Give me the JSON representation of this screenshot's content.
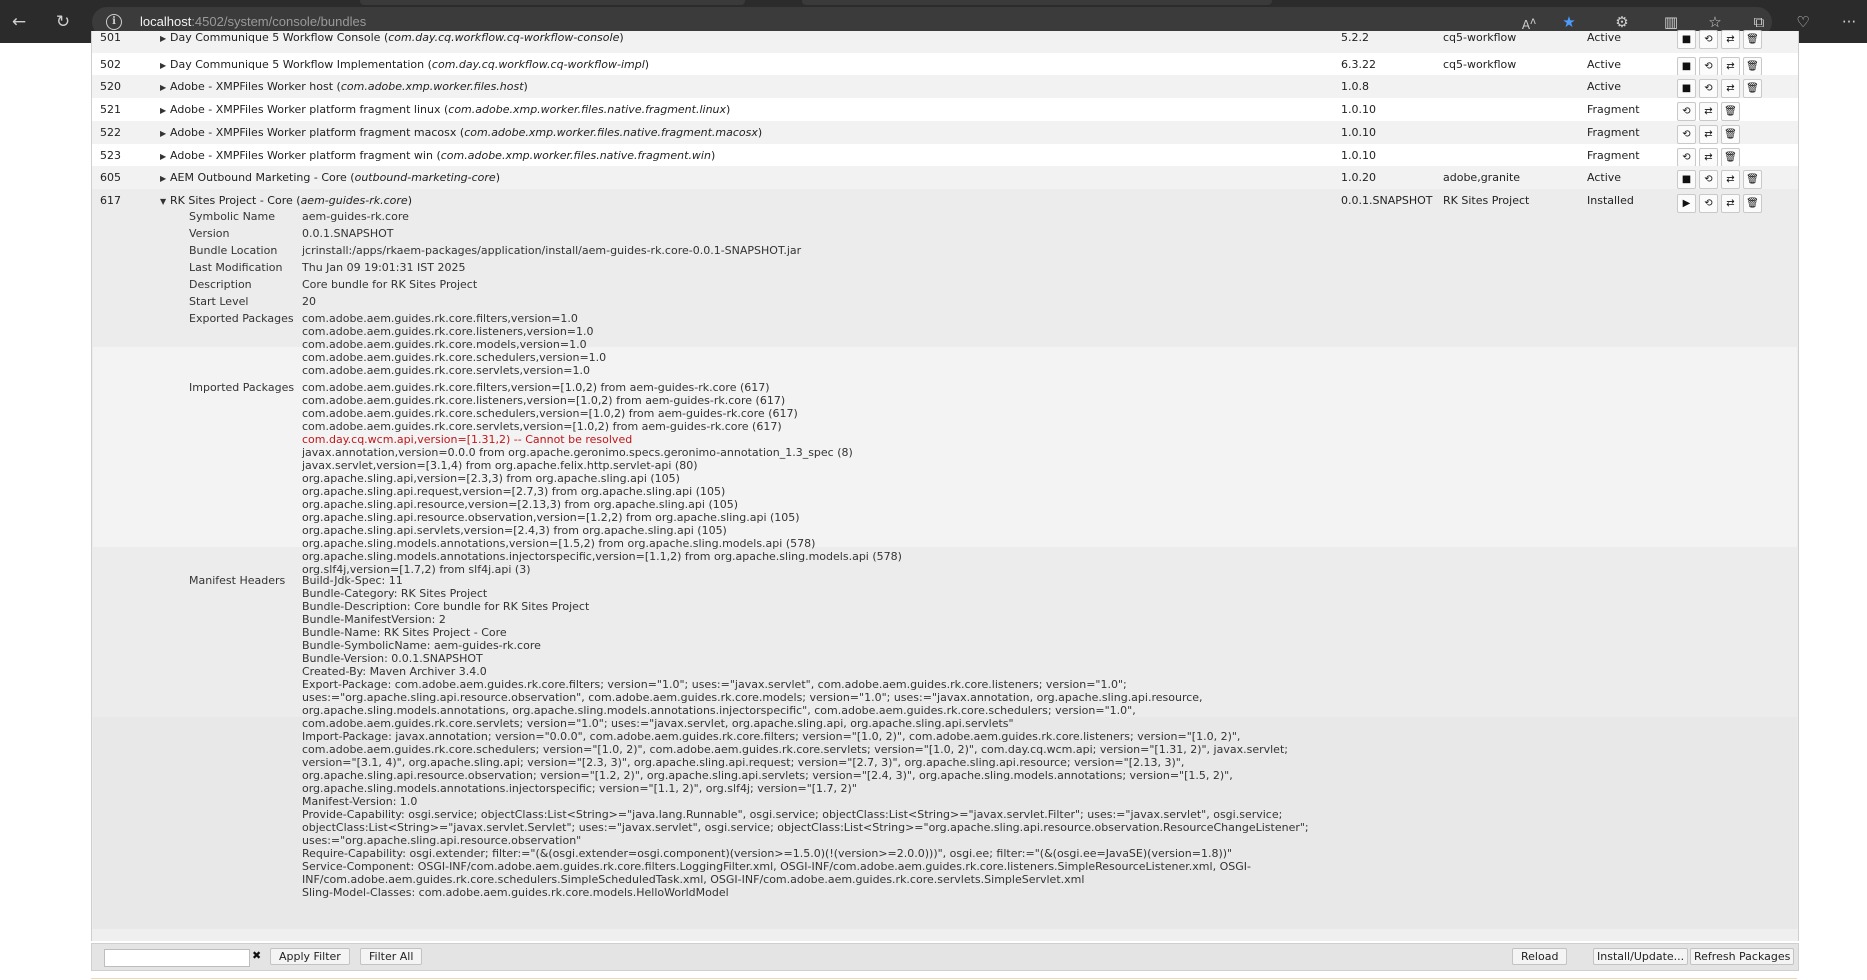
{
  "browser": {
    "url_host": "localhost",
    "url_rest": ":4502/system/console/bundles"
  },
  "rows": [
    {
      "id": "501",
      "name": "Day Communique 5 Workflow Console",
      "sym": "com.day.cq.workflow.cq-workflow-console",
      "version": "5.2.2",
      "category": "cq5-workflow",
      "status": "Active"
    },
    {
      "id": "502",
      "name": "Day Communique 5 Workflow Implementation",
      "sym": "com.day.cq.workflow.cq-workflow-impl",
      "version": "6.3.22",
      "category": "cq5-workflow",
      "status": "Active"
    },
    {
      "id": "520",
      "name": "Adobe - XMPFiles Worker host",
      "sym": "com.adobe.xmp.worker.files.host",
      "version": "1.0.8",
      "category": "",
      "status": "Active"
    },
    {
      "id": "521",
      "name": "Adobe - XMPFiles Worker platform fragment linux",
      "sym": "com.adobe.xmp.worker.files.native.fragment.linux",
      "version": "1.0.10",
      "category": "",
      "status": "Fragment"
    },
    {
      "id": "522",
      "name": "Adobe - XMPFiles Worker platform fragment macosx",
      "sym": "com.adobe.xmp.worker.files.native.fragment.macosx",
      "version": "1.0.10",
      "category": "",
      "status": "Fragment"
    },
    {
      "id": "523",
      "name": "Adobe - XMPFiles Worker platform fragment win",
      "sym": "com.adobe.xmp.worker.files.native.fragment.win",
      "version": "1.0.10",
      "category": "",
      "status": "Fragment"
    },
    {
      "id": "605",
      "name": "AEM Outbound Marketing - Core",
      "sym": "outbound-marketing-core",
      "version": "1.0.20",
      "category": "adobe,granite",
      "status": "Active"
    }
  ],
  "expanded": {
    "id": "617",
    "name": "RK Sites Project - Core",
    "sym": "aem-guides-rk.core",
    "version": "0.0.1.SNAPSHOT",
    "category": "RK Sites Project",
    "status": "Installed",
    "labels": {
      "symbolic_name": "Symbolic Name",
      "version": "Version",
      "bundle_location": "Bundle Location",
      "last_modification": "Last Modification",
      "description": "Description",
      "start_level": "Start Level",
      "exported_packages": "Exported Packages",
      "imported_packages": "Imported Packages",
      "manifest_headers": "Manifest Headers"
    },
    "symbolic_name": "aem-guides-rk.core",
    "version_value": "0.0.1.SNAPSHOT",
    "bundle_location": "jcrinstall:/apps/rkaem-packages/application/install/aem-guides-rk.core-0.0.1-SNAPSHOT.jar",
    "last_modification": "Thu Jan 09 19:01:31 IST 2025",
    "description": "Core bundle for RK Sites Project",
    "start_level": "20",
    "exported_packages": "com.adobe.aem.guides.rk.core.filters,version=1.0\ncom.adobe.aem.guides.rk.core.listeners,version=1.0\ncom.adobe.aem.guides.rk.core.models,version=1.0\ncom.adobe.aem.guides.rk.core.schedulers,version=1.0\ncom.adobe.aem.guides.rk.core.servlets,version=1.0",
    "imported_before": "com.adobe.aem.guides.rk.core.filters,version=[1.0,2) from aem-guides-rk.core (617)\ncom.adobe.aem.guides.rk.core.listeners,version=[1.0,2) from aem-guides-rk.core (617)\ncom.adobe.aem.guides.rk.core.schedulers,version=[1.0,2) from aem-guides-rk.core (617)\ncom.adobe.aem.guides.rk.core.servlets,version=[1.0,2) from aem-guides-rk.core (617)",
    "imported_error": "com.day.cq.wcm.api,version=[1.31,2) -- Cannot be resolved",
    "imported_after": "javax.annotation,version=0.0.0 from org.apache.geronimo.specs.geronimo-annotation_1.3_spec (8)\njavax.servlet,version=[3.1,4) from org.apache.felix.http.servlet-api (80)\norg.apache.sling.api,version=[2.3,3) from org.apache.sling.api (105)\norg.apache.sling.api.request,version=[2.7,3) from org.apache.sling.api (105)\norg.apache.sling.api.resource,version=[2.13,3) from org.apache.sling.api (105)\norg.apache.sling.api.resource.observation,version=[1.2,2) from org.apache.sling.api (105)\norg.apache.sling.api.servlets,version=[2.4,3) from org.apache.sling.api (105)\norg.apache.sling.models.annotations,version=[1.5,2) from org.apache.sling.models.api (578)\norg.apache.sling.models.annotations.injectorspecific,version=[1.1,2) from org.apache.sling.models.api (578)\norg.slf4j,version=[1.7,2) from slf4j.api (3)",
    "manifest": "Build-Jdk-Spec: 11\nBundle-Category: RK Sites Project\nBundle-Description: Core bundle for RK Sites Project\nBundle-ManifestVersion: 2\nBundle-Name: RK Sites Project - Core\nBundle-SymbolicName: aem-guides-rk.core\nBundle-Version: 0.0.1.SNAPSHOT\nCreated-By: Maven Archiver 3.4.0\nExport-Package: com.adobe.aem.guides.rk.core.filters; version=\"1.0\"; uses:=\"javax.servlet\", com.adobe.aem.guides.rk.core.listeners; version=\"1.0\";\nuses:=\"org.apache.sling.api.resource.observation\", com.adobe.aem.guides.rk.core.models; version=\"1.0\"; uses:=\"javax.annotation, org.apache.sling.api.resource,\norg.apache.sling.models.annotations, org.apache.sling.models.annotations.injectorspecific\", com.adobe.aem.guides.rk.core.schedulers; version=\"1.0\",\ncom.adobe.aem.guides.rk.core.servlets; version=\"1.0\"; uses:=\"javax.servlet, org.apache.sling.api, org.apache.sling.api.servlets\"\nImport-Package: javax.annotation; version=\"0.0.0\", com.adobe.aem.guides.rk.core.filters; version=\"[1.0, 2)\", com.adobe.aem.guides.rk.core.listeners; version=\"[1.0, 2)\",\ncom.adobe.aem.guides.rk.core.schedulers; version=\"[1.0, 2)\", com.adobe.aem.guides.rk.core.servlets; version=\"[1.0, 2)\", com.day.cq.wcm.api; version=\"[1.31, 2)\", javax.servlet;\nversion=\"[3.1, 4)\", org.apache.sling.api; version=\"[2.3, 3)\", org.apache.sling.api.request; version=\"[2.7, 3)\", org.apache.sling.api.resource; version=\"[2.13, 3)\",\norg.apache.sling.api.resource.observation; version=\"[1.2, 2)\", org.apache.sling.api.servlets; version=\"[2.4, 3)\", org.apache.sling.models.annotations; version=\"[1.5, 2)\",\norg.apache.sling.models.annotations.injectorspecific; version=\"[1.1, 2)\", org.slf4j; version=\"[1.7, 2)\"\nManifest-Version: 1.0\nProvide-Capability: osgi.service; objectClass:List<String>=\"java.lang.Runnable\", osgi.service; objectClass:List<String>=\"javax.servlet.Filter\"; uses:=\"javax.servlet\", osgi.service;\nobjectClass:List<String>=\"javax.servlet.Servlet\"; uses:=\"javax.servlet\", osgi.service; objectClass:List<String>=\"org.apache.sling.api.resource.observation.ResourceChangeListener\";\nuses:=\"org.apache.sling.api.resource.observation\"\nRequire-Capability: osgi.extender; filter:=\"(&(osgi.extender=osgi.component)(version>=1.5.0)(!(version>=2.0.0)))\", osgi.ee; filter:=\"(&(osgi.ee=JavaSE)(version=1.8))\"\nService-Component: OSGI-INF/com.adobe.aem.guides.rk.core.filters.LoggingFilter.xml, OSGI-INF/com.adobe.aem.guides.rk.core.listeners.SimpleResourceListener.xml, OSGI-\nINF/com.adobe.aem.guides.rk.core.schedulers.SimpleScheduledTask.xml, OSGI-INF/com.adobe.aem.guides.rk.core.servlets.SimpleServlet.xml\nSling-Model-Classes: com.adobe.aem.guides.rk.core.models.HelloWorldModel"
  },
  "footer": {
    "filter_placeholder": "",
    "clear": "✖",
    "apply_filter": "Apply Filter",
    "filter_all": "Filter All",
    "reload": "Reload",
    "install_update": "Install/Update...",
    "refresh_packages": "Refresh Packages"
  },
  "action_glyphs": {
    "stop": "■",
    "start": "▶",
    "refresh": "⟲",
    "update": "⇄",
    "uninstall": "🗑"
  }
}
